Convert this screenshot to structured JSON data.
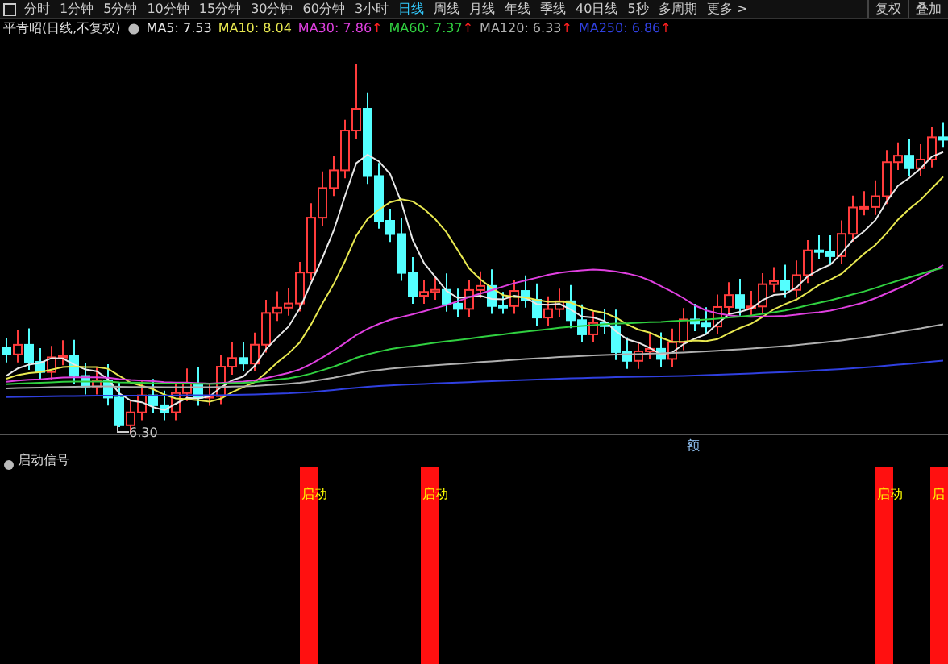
{
  "toolbar": {
    "tabs": [
      {
        "label": "分时",
        "selected": false
      },
      {
        "label": "1分钟",
        "selected": false
      },
      {
        "label": "5分钟",
        "selected": false
      },
      {
        "label": "10分钟",
        "selected": false
      },
      {
        "label": "15分钟",
        "selected": false
      },
      {
        "label": "30分钟",
        "selected": false
      },
      {
        "label": "60分钟",
        "selected": false
      },
      {
        "label": "3小时",
        "selected": false
      },
      {
        "label": "日线",
        "selected": true
      },
      {
        "label": "周线",
        "selected": false
      },
      {
        "label": "月线",
        "selected": false
      },
      {
        "label": "年线",
        "selected": false
      },
      {
        "label": "季线",
        "selected": false
      },
      {
        "label": "40日线",
        "selected": false
      },
      {
        "label": "5秒",
        "selected": false
      },
      {
        "label": "多周期",
        "selected": false
      },
      {
        "label": "更多 >",
        "selected": false
      }
    ],
    "right_buttons": [
      "复权",
      "叠加"
    ]
  },
  "legend": {
    "title": "平青昭(日线,不复权)",
    "items": [
      {
        "label": "MA5: 7.53",
        "color": "#e8e8e8"
      },
      {
        "label": "MA10: 8.04",
        "color": "#e8e850"
      },
      {
        "label": "MA30: 7.86",
        "color": "#e040e0",
        "arrow": "↑"
      },
      {
        "label": "MA60: 7.37",
        "color": "#30d040",
        "arrow": "↑"
      },
      {
        "label": "MA120: 6.33",
        "color": "#b0b0b0",
        "arrow": "↑"
      },
      {
        "label": "MA250: 6.86",
        "color": "#3040e0",
        "arrow": "↑"
      }
    ]
  },
  "chart": {
    "low_label": "6.30",
    "marker": "额"
  },
  "indicator": {
    "title": "启动信号",
    "signals": [
      {
        "label": "启动"
      },
      {
        "label": "启动"
      },
      {
        "label": "启动"
      },
      {
        "label": "启"
      }
    ]
  }
}
